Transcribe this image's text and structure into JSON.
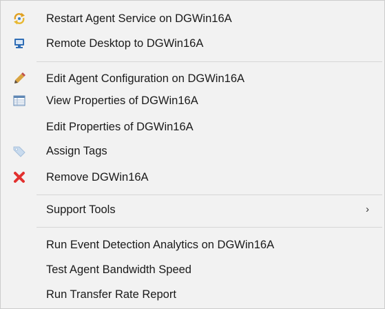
{
  "menu": {
    "items": [
      {
        "label": "Restart Agent Service on DGWin16A",
        "icon": "restart-service-icon"
      },
      {
        "label": "Remote Desktop to DGWin16A",
        "icon": "remote-desktop-icon"
      },
      {
        "label": "Edit Agent Configuration on DGWin16A",
        "icon": "pencil-icon"
      },
      {
        "label": "View Properties of DGWin16A",
        "icon": "properties-table-icon"
      },
      {
        "label": "Edit Properties of DGWin16A",
        "icon": ""
      },
      {
        "label": "Assign Tags",
        "icon": "tag-icon"
      },
      {
        "label": "Remove DGWin16A",
        "icon": "remove-x-icon"
      },
      {
        "label": "Support Tools",
        "icon": "",
        "submenu_arrow": "›"
      },
      {
        "label": "Run Event Detection Analytics on DGWin16A",
        "icon": ""
      },
      {
        "label": "Test Agent Bandwidth Speed",
        "icon": ""
      },
      {
        "label": "Run Transfer Rate Report",
        "icon": ""
      }
    ]
  },
  "colors": {
    "background": "#f2f2f2",
    "separator": "#d6d6d6",
    "text": "#1a1a1a",
    "remove_red": "#e2312f",
    "desktop_blue": "#2f6db5",
    "tag_blue": "#b9cfe6"
  }
}
